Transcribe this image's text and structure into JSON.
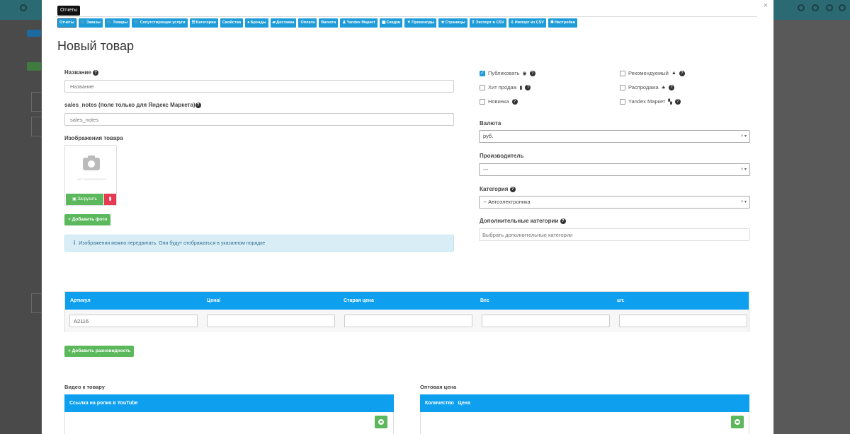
{
  "modal": {
    "tooltip": "Отчеты",
    "close": "×",
    "tabs": [
      {
        "label": "Отчеты",
        "icon": ""
      },
      {
        "label": "Заказы",
        "icon": "cart-icon"
      },
      {
        "label": "Товары",
        "icon": "cart-icon"
      },
      {
        "label": "Сопутствующие услуги",
        "icon": "cart-icon"
      },
      {
        "label": "Категории",
        "icon": "list-icon"
      },
      {
        "label": "Свойства",
        "icon": ""
      },
      {
        "label": "Бренды",
        "icon": "bell-icon"
      },
      {
        "label": "Доставка",
        "icon": "truck-icon"
      },
      {
        "label": "Оплата",
        "icon": ""
      },
      {
        "label": "Валюта",
        "icon": ""
      },
      {
        "label": "Yandex Маркет",
        "icon": "user-icon"
      },
      {
        "label": "Скидки",
        "icon": "gift-icon"
      },
      {
        "label": "Промокоды",
        "icon": "trophy-icon"
      },
      {
        "label": "Страницы",
        "icon": "star-icon"
      },
      {
        "label": "Экспорт в CSV",
        "icon": "upload-icon"
      },
      {
        "label": "Импорт из CSV",
        "icon": "download-icon"
      },
      {
        "label": "Настройки",
        "icon": "gear-icon"
      }
    ],
    "title": "Новый товар"
  },
  "form": {
    "name_label": "Название",
    "name_placeholder": "Название",
    "sales_label": "sales_notes (поле только для Яндекс Маркета)",
    "sales_placeholder": "sales_notes",
    "images_label": "Изображения товара",
    "no_image": "НЕТ ИЗОБРАЖЕНИЯ",
    "upload_label": "Загрузить",
    "add_photo_label": "+ Добавить фото",
    "alert_text": "Изображения можно передвигать. Они будут отображаться в указанном порядке"
  },
  "flags": {
    "publish": "Публиковать",
    "hit": "Хит продаж",
    "new": "Новинка",
    "recommended": "Рекомендуемый",
    "sale": "Распродажа",
    "yandex": "Yandex Маркет"
  },
  "selects": {
    "currency_label": "Валюта",
    "currency_value": "руб.",
    "producer_label": "Производитель",
    "producer_value": "---",
    "category_label": "Категория",
    "category_value": "-- Автоэлектроника",
    "extra_label": "Дополнительные категории",
    "extra_placeholder": "Выбрать дополнительные категории",
    "clear": "× ▾"
  },
  "variants": {
    "headers": [
      "Артикул",
      "Цена/",
      "Старая цена",
      "Вес",
      "шт."
    ],
    "values": [
      "A2116",
      "",
      "",
      "",
      ""
    ],
    "add_label": "+ Добавить разновидность"
  },
  "video": {
    "title": "Видео к товару",
    "header": "Ссылка на ролик в YouTube"
  },
  "wholesale": {
    "title": "Оптовая цена",
    "header": "Количество   Цена"
  },
  "colors": {
    "accent": "#1e9cd8",
    "table_header": "#0ea0ee",
    "success": "#5cb85c",
    "danger": "#e53a52"
  }
}
